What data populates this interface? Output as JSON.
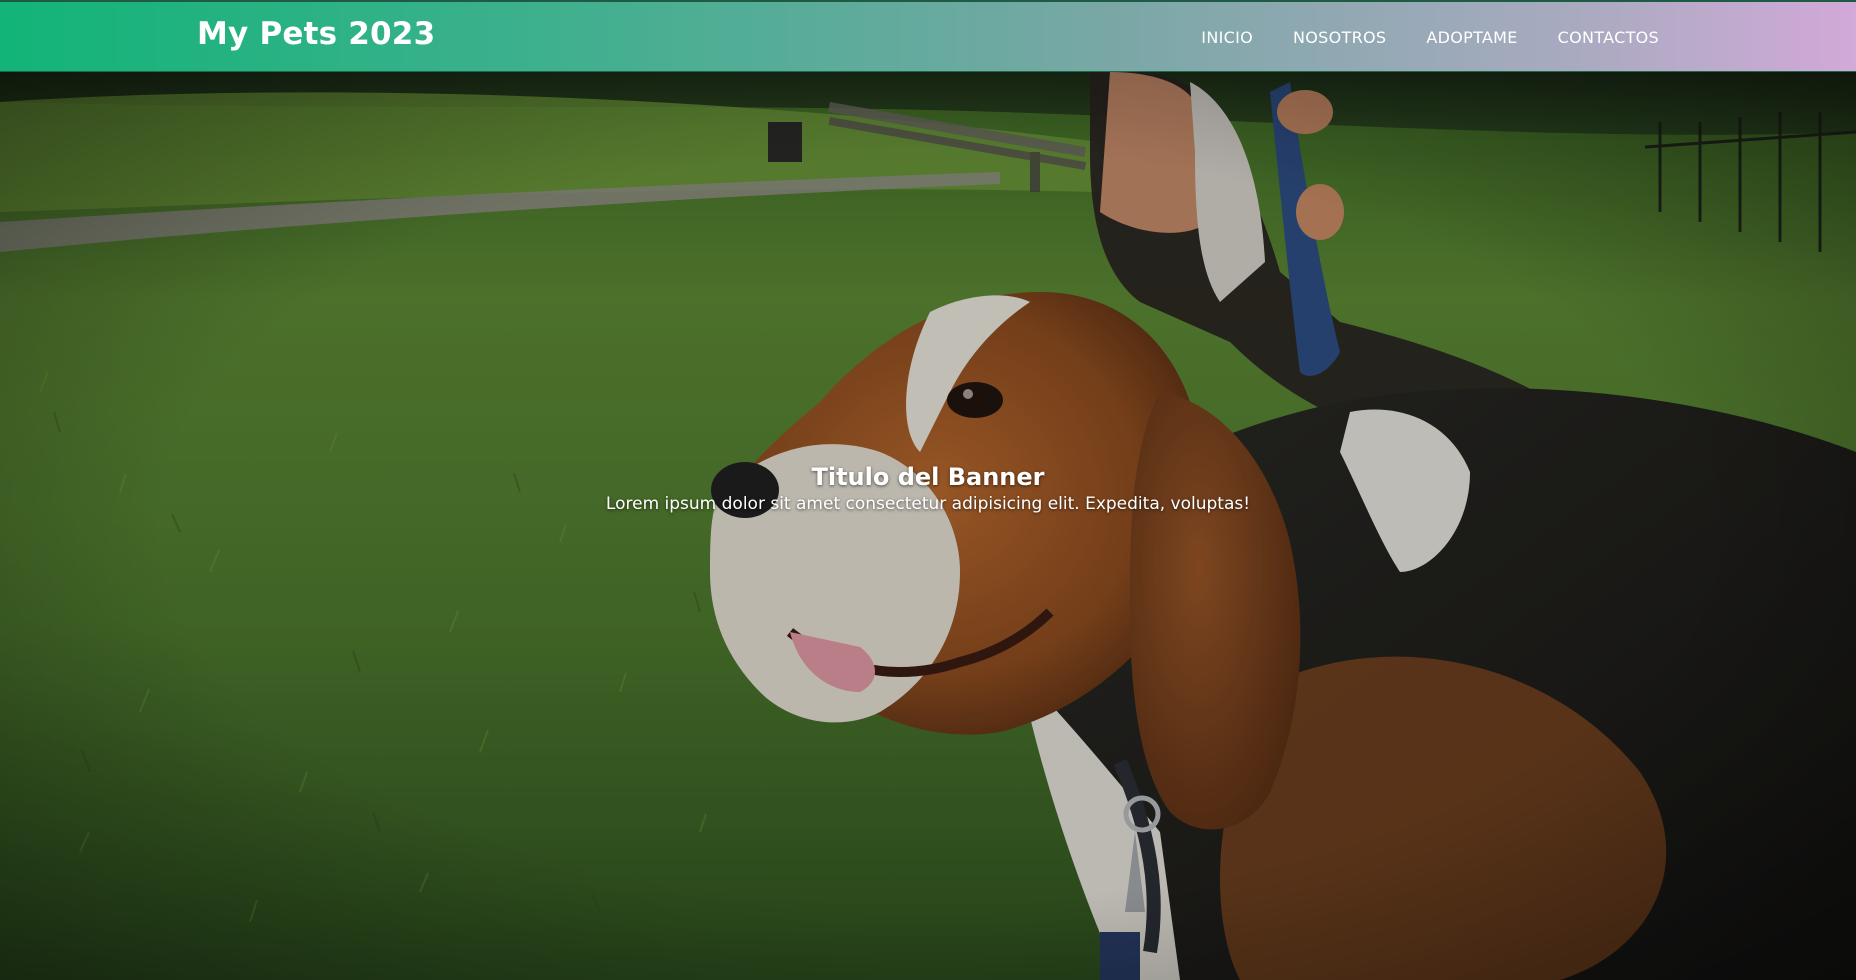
{
  "header": {
    "brand": "My Pets 2023",
    "nav": [
      "INICIO",
      "NOSOTROS",
      "ADOPTAME",
      "CONTACTOS"
    ]
  },
  "banner": {
    "title": "Titulo del Banner",
    "subtitle": "Lorem ipsum dolor sit amet consectetur adipisicing elit. Expedita, voluptas!",
    "image_subject": "beagle dog on grass"
  },
  "colors": {
    "header_gradient_start": "#12b478",
    "header_gradient_end": "#d2a9d8",
    "text": "#ffffff"
  }
}
